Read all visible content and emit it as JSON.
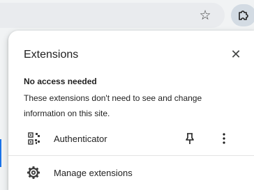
{
  "toolbar": {
    "bookmark_icon": "star-outline-icon",
    "extensions_icon": "puzzle-icon"
  },
  "panel": {
    "title": "Extensions",
    "close_icon": "close-icon",
    "section_heading": "No access needed",
    "section_description": "These extensions don't need to see and change information on this site.",
    "extensions": [
      {
        "name": "Authenticator",
        "icon": "qr-code-icon",
        "pin_icon": "pin-icon",
        "more_icon": "more-vertical-icon"
      }
    ],
    "manage_label": "Manage extensions",
    "manage_icon": "gear-icon"
  },
  "colors": {
    "toolbar_bg": "#f1f3f4",
    "omnibox_bg": "#e9ebee",
    "extension_button_bg": "#d3dbe3",
    "panel_bg": "#ffffff",
    "accent": "#1a73e8"
  }
}
